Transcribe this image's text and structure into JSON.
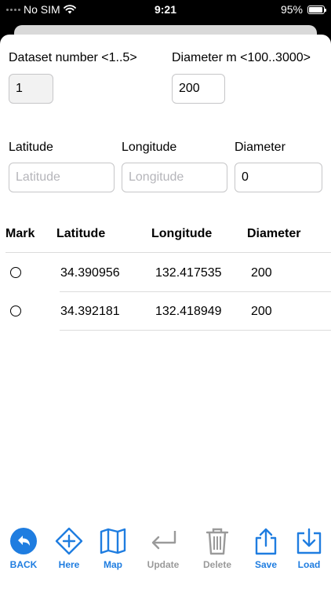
{
  "status": {
    "carrier": "No SIM",
    "time": "9:21",
    "battery": "95%",
    "battery_level": 0.95
  },
  "form": {
    "dataset_label": "Dataset number <1..5>",
    "dataset_value": "1",
    "diameter_label": "Diameter m <100..3000>",
    "diameter_value": "200",
    "latitude_label": "Latitude",
    "latitude_placeholder": "Latitude",
    "longitude_label": "Longitude",
    "longitude_placeholder": "Longitude",
    "point_diameter_label": "Diameter",
    "point_diameter_value": "0"
  },
  "table": {
    "headers": [
      "Mark",
      "Latitude",
      "Longitude",
      "Diameter"
    ],
    "rows": [
      {
        "latitude": "34.390956",
        "longitude": "132.417535",
        "diameter": "200"
      },
      {
        "latitude": "34.392181",
        "longitude": "132.418949",
        "diameter": "200"
      }
    ]
  },
  "toolbar": {
    "items": [
      {
        "label": "BACK",
        "icon": "back-arrow-icon",
        "state": "active"
      },
      {
        "label": "Here",
        "icon": "plus-diamond-icon",
        "state": "active"
      },
      {
        "label": "Map",
        "icon": "map-icon",
        "state": "active"
      },
      {
        "label": "Update",
        "icon": "return-arrow-icon",
        "state": "disabled"
      },
      {
        "label": "Delete",
        "icon": "trash-icon",
        "state": "disabled"
      },
      {
        "label": "Save",
        "icon": "share-icon",
        "state": "active"
      },
      {
        "label": "Load",
        "icon": "download-icon",
        "state": "active"
      }
    ]
  },
  "colors": {
    "accent": "#1f7de0",
    "disabled": "#9a9a9a"
  }
}
